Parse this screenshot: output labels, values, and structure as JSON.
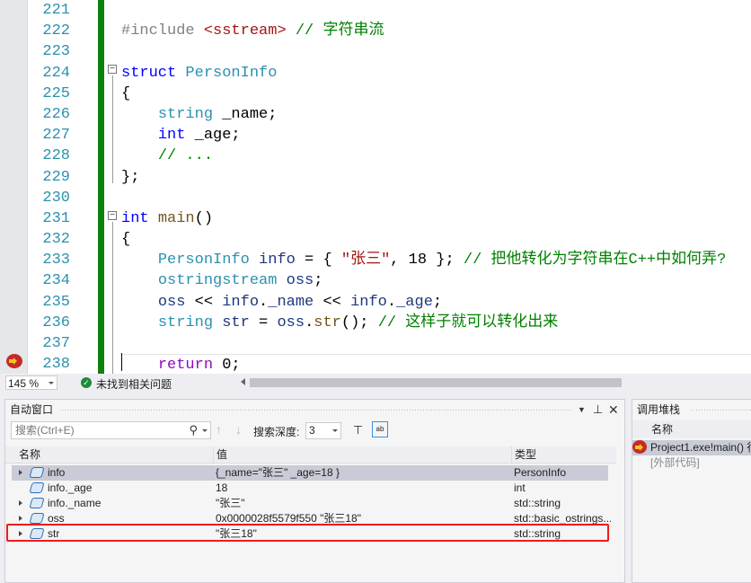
{
  "editor": {
    "line_numbers": [
      "221",
      "222",
      "223",
      "224",
      "225",
      "226",
      "227",
      "228",
      "229",
      "230",
      "231",
      "232",
      "233",
      "234",
      "235",
      "236",
      "237",
      "238"
    ],
    "lines": [
      [],
      [
        [
          "#include ",
          "pp"
        ],
        [
          "<sstream>",
          "st"
        ],
        [
          " // 字符串流",
          "cm"
        ]
      ],
      [],
      [
        [
          "struct ",
          "kw"
        ],
        [
          "PersonInfo",
          "ty"
        ]
      ],
      [
        [
          "{",
          "pu"
        ]
      ],
      [
        [
          "    ",
          "pu"
        ],
        [
          "string",
          "ty"
        ],
        [
          " _name;",
          "pu"
        ]
      ],
      [
        [
          "    ",
          "pu"
        ],
        [
          "int",
          "kw"
        ],
        [
          " _age;",
          "pu"
        ]
      ],
      [
        [
          "    ",
          "pu"
        ],
        [
          "// ...",
          "cm"
        ]
      ],
      [
        [
          "};",
          "pu"
        ]
      ],
      [],
      [
        [
          "int ",
          "kw"
        ],
        [
          "main",
          "fn"
        ],
        [
          "()",
          "pu"
        ]
      ],
      [
        [
          "{",
          "pu"
        ]
      ],
      [
        [
          "    ",
          "pu"
        ],
        [
          "PersonInfo",
          "ty"
        ],
        [
          " info",
          "va"
        ],
        [
          " = { ",
          "pu"
        ],
        [
          "\"张三\"",
          "st"
        ],
        [
          ", 18 }; ",
          "pu"
        ],
        [
          "// 把他转化为字符串在C++中如何弄?",
          "cm"
        ]
      ],
      [
        [
          "    ",
          "pu"
        ],
        [
          "ostringstream",
          "ty"
        ],
        [
          " oss",
          "va"
        ],
        [
          ";",
          "pu"
        ]
      ],
      [
        [
          "    ",
          "pu"
        ],
        [
          "oss",
          "va"
        ],
        [
          " << ",
          "pu"
        ],
        [
          "info",
          "va"
        ],
        [
          ".",
          "pu"
        ],
        [
          "_name",
          "va"
        ],
        [
          " << ",
          "pu"
        ],
        [
          "info",
          "va"
        ],
        [
          ".",
          "pu"
        ],
        [
          "_age",
          "va"
        ],
        [
          ";",
          "pu"
        ]
      ],
      [
        [
          "    ",
          "pu"
        ],
        [
          "string",
          "ty"
        ],
        [
          " str",
          "va"
        ],
        [
          " = ",
          "pu"
        ],
        [
          "oss",
          "va"
        ],
        [
          ".",
          "pu"
        ],
        [
          "str",
          "fn"
        ],
        [
          "(); ",
          "pu"
        ],
        [
          "// 这样子就可以转化出来",
          "cm"
        ]
      ],
      [],
      [
        [
          "    ",
          "pu"
        ],
        [
          "return",
          "rt"
        ],
        [
          " 0;",
          "pu"
        ]
      ]
    ]
  },
  "status": {
    "zoom": "145 %",
    "issues": "未找到相关问题"
  },
  "autos": {
    "title": "自动窗口",
    "search_placeholder": "搜索(Ctrl+E)",
    "depth_label": "搜索深度:",
    "depth_value": "3",
    "columns": {
      "name": "名称",
      "value": "值",
      "type": "类型"
    },
    "rows": [
      {
        "name": "info",
        "value": "{_name=\"张三\" _age=18 }",
        "type": "PersonInfo",
        "expandable": true,
        "selected": true
      },
      {
        "name": "info._age",
        "value": "18",
        "type": "int",
        "expandable": false,
        "selected": false
      },
      {
        "name": "info._name",
        "value": "\"张三\"",
        "type": "std::string",
        "expandable": true,
        "selected": false
      },
      {
        "name": "oss",
        "value": "0x0000028f5579f550 \"张三18\"",
        "type": "std::basic_ostrings...",
        "expandable": true,
        "selected": false
      },
      {
        "name": "str",
        "value": "\"张三18\"",
        "type": "std::string",
        "expandable": true,
        "selected": false,
        "highlighted": true
      }
    ]
  },
  "callstack": {
    "title": "调用堆栈",
    "column": "名称",
    "frames": [
      "Project1.exe!main() 行",
      "[外部代码]"
    ]
  },
  "colors": {
    "highlight_box": "#f21a1a",
    "change_bar": "#108010",
    "keyword": "#0000ff",
    "type": "#2b91af",
    "comment": "#008000",
    "string": "#a31515"
  }
}
